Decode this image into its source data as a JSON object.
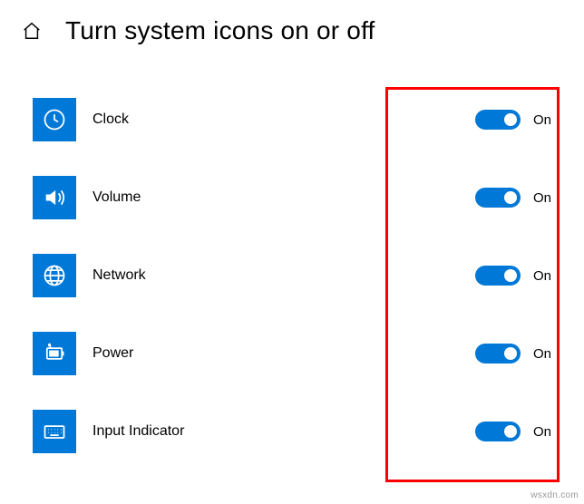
{
  "header": {
    "title": "Turn system icons on or off"
  },
  "items": [
    {
      "id": "clock",
      "label": "Clock",
      "state": "On",
      "icon": "clock-icon"
    },
    {
      "id": "volume",
      "label": "Volume",
      "state": "On",
      "icon": "volume-icon"
    },
    {
      "id": "network",
      "label": "Network",
      "state": "On",
      "icon": "network-icon"
    },
    {
      "id": "power",
      "label": "Power",
      "state": "On",
      "icon": "power-icon"
    },
    {
      "id": "input-indicator",
      "label": "Input Indicator",
      "state": "On",
      "icon": "keyboard-icon"
    }
  ],
  "watermark": "wsxdn.com",
  "colors": {
    "accent": "#0078d7",
    "highlight": "#f00"
  }
}
